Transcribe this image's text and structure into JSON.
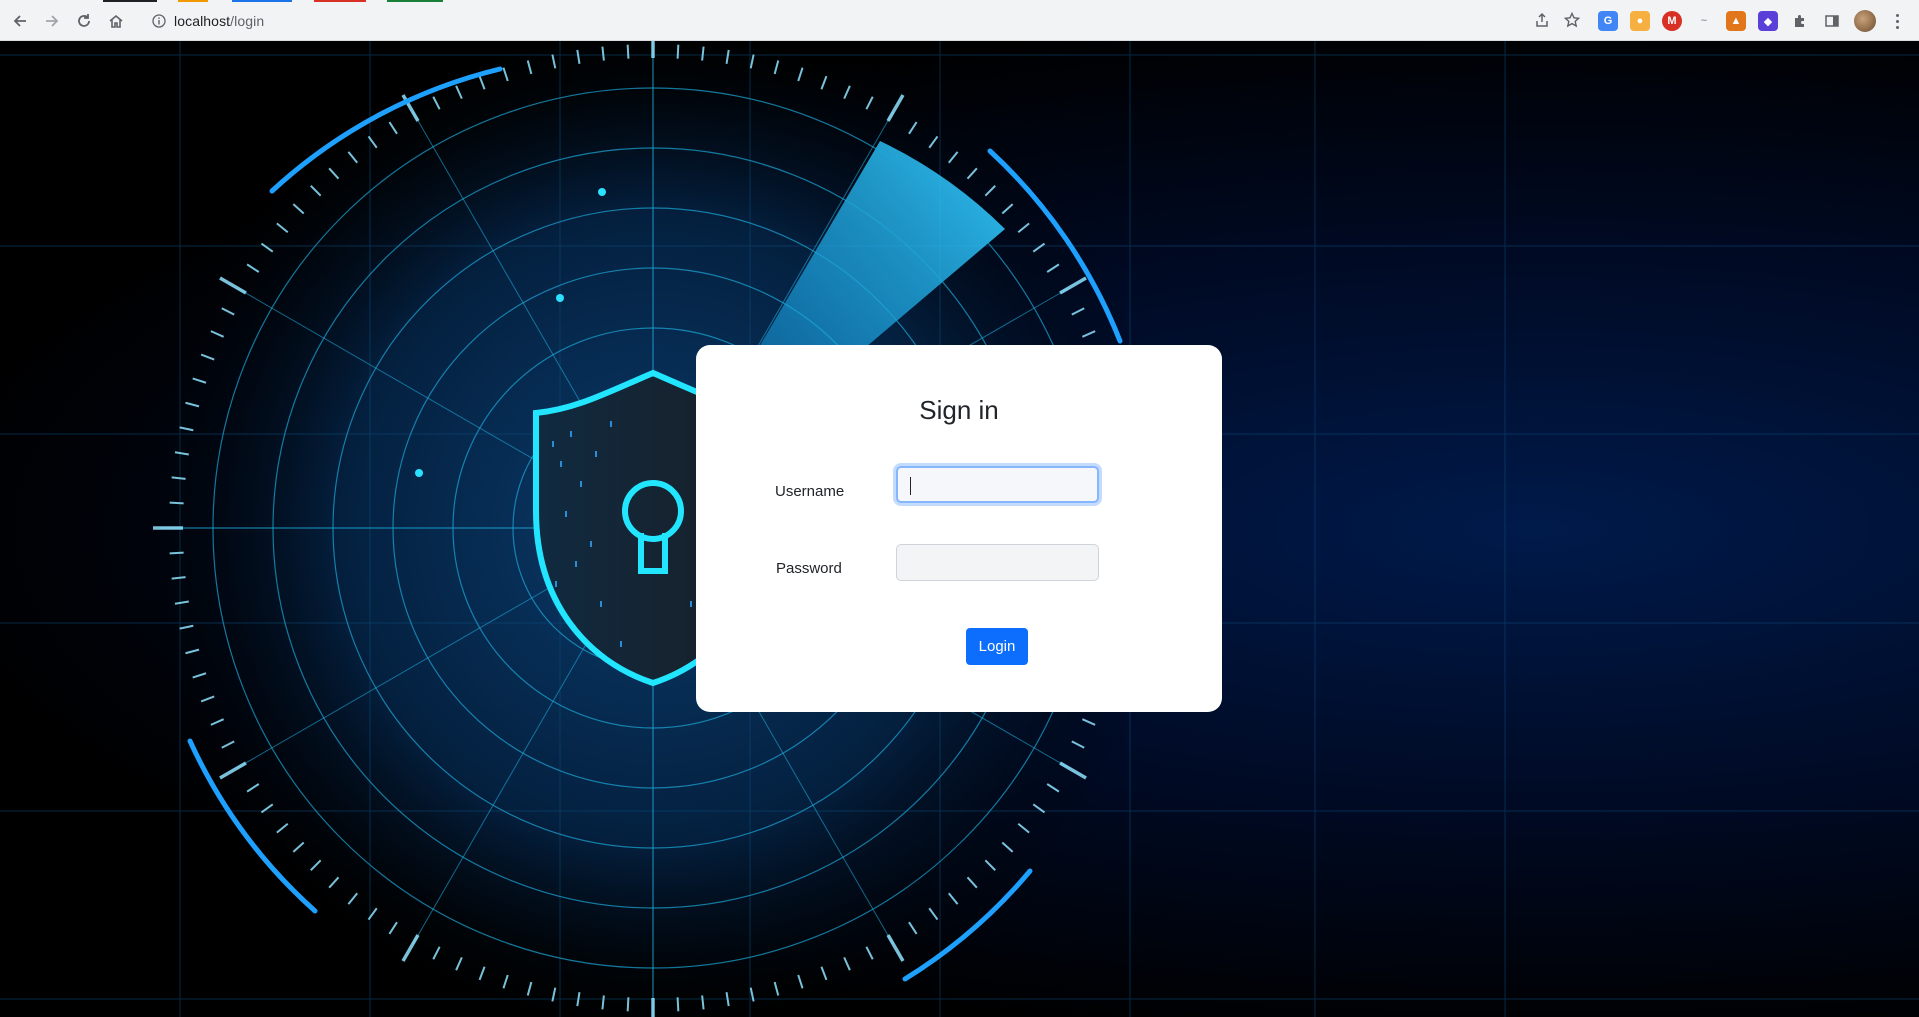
{
  "browser": {
    "url_host": "localhost",
    "url_path": "/login"
  },
  "login": {
    "title": "Sign in",
    "username_label": "Username",
    "username_value": "",
    "password_label": "Password",
    "password_value": "",
    "submit_label": "Login"
  },
  "colors": {
    "primary": "#0d6efd",
    "focus_ring": "#86b7fe",
    "cyan": "#14d9ff"
  },
  "icons": {
    "back": "back-arrow-icon",
    "forward": "forward-arrow-icon",
    "reload": "reload-icon",
    "home": "home-icon",
    "info": "info-icon",
    "share": "share-icon",
    "bookmark": "star-icon",
    "extensions": "puzzle-icon",
    "side_panel": "side-panel-icon",
    "menu": "kebab-menu-icon",
    "hero": "security-shield-keyhole-icon"
  }
}
